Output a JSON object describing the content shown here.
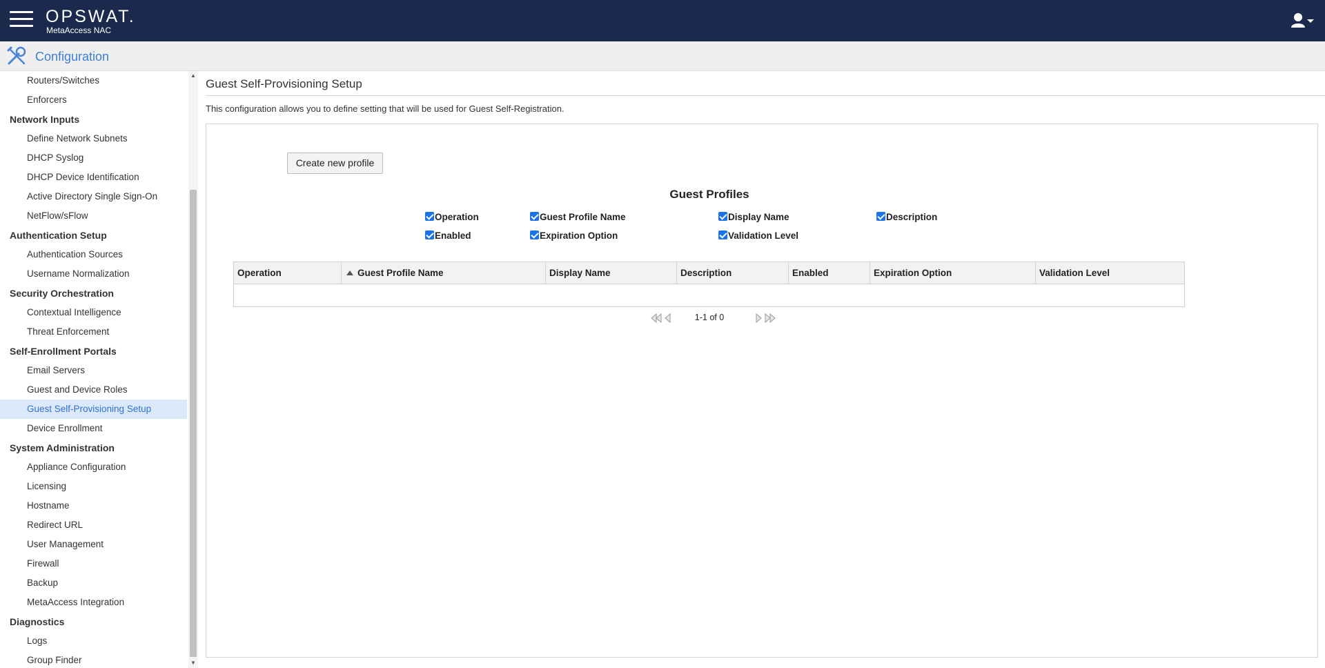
{
  "header": {
    "brand": "OPSWAT.",
    "product": "MetaAccess NAC"
  },
  "section": {
    "title": "Configuration"
  },
  "sidebar": {
    "items": [
      {
        "label": "Routers/Switches",
        "kind": "child"
      },
      {
        "label": "Enforcers",
        "kind": "child"
      },
      {
        "label": "Network Inputs",
        "kind": "group"
      },
      {
        "label": "Define Network Subnets",
        "kind": "child"
      },
      {
        "label": "DHCP Syslog",
        "kind": "child"
      },
      {
        "label": "DHCP Device Identification",
        "kind": "child"
      },
      {
        "label": "Active Directory Single Sign-On",
        "kind": "child"
      },
      {
        "label": "NetFlow/sFlow",
        "kind": "child"
      },
      {
        "label": "Authentication Setup",
        "kind": "group"
      },
      {
        "label": "Authentication Sources",
        "kind": "child"
      },
      {
        "label": "Username Normalization",
        "kind": "child"
      },
      {
        "label": "Security Orchestration",
        "kind": "group"
      },
      {
        "label": "Contextual Intelligence",
        "kind": "child"
      },
      {
        "label": "Threat Enforcement",
        "kind": "child"
      },
      {
        "label": "Self-Enrollment Portals",
        "kind": "group"
      },
      {
        "label": "Email Servers",
        "kind": "child"
      },
      {
        "label": "Guest and Device Roles",
        "kind": "child"
      },
      {
        "label": "Guest Self-Provisioning Setup",
        "kind": "child",
        "active": true
      },
      {
        "label": "Device Enrollment",
        "kind": "child"
      },
      {
        "label": "System Administration",
        "kind": "group"
      },
      {
        "label": "Appliance Configuration",
        "kind": "child"
      },
      {
        "label": "Licensing",
        "kind": "child"
      },
      {
        "label": "Hostname",
        "kind": "child"
      },
      {
        "label": "Redirect URL",
        "kind": "child"
      },
      {
        "label": "User Management",
        "kind": "child"
      },
      {
        "label": "Firewall",
        "kind": "child"
      },
      {
        "label": "Backup",
        "kind": "child"
      },
      {
        "label": "MetaAccess Integration",
        "kind": "child"
      },
      {
        "label": "Diagnostics",
        "kind": "group"
      },
      {
        "label": "Logs",
        "kind": "child"
      },
      {
        "label": "Group Finder",
        "kind": "child"
      }
    ]
  },
  "main": {
    "title": "Guest Self-Provisioning Setup",
    "description": "This configuration allows you to define setting that will be used for Guest Self-Registration.",
    "create_button": "Create new profile",
    "grid_title": "Guest Profiles",
    "column_toggles": [
      {
        "label": "Operation",
        "checked": true
      },
      {
        "label": "Guest Profile Name",
        "checked": true
      },
      {
        "label": "Display Name",
        "checked": true
      },
      {
        "label": "Description",
        "checked": true
      },
      {
        "label": "Enabled",
        "checked": true
      },
      {
        "label": "Expiration Option",
        "checked": true
      },
      {
        "label": "Validation Level",
        "checked": true
      }
    ],
    "columns": [
      {
        "label": "Operation"
      },
      {
        "label": "Guest Profile Name",
        "sorted": "asc"
      },
      {
        "label": "Display Name"
      },
      {
        "label": "Description"
      },
      {
        "label": "Enabled"
      },
      {
        "label": "Expiration Option"
      },
      {
        "label": "Validation Level"
      }
    ],
    "pager": {
      "text": "1-1 of 0"
    }
  },
  "colors": {
    "topbar": "#1b2a4c",
    "accent": "#3b7ed6",
    "active_bg": "#dbe9fb",
    "checkbox": "#1a73e8"
  }
}
